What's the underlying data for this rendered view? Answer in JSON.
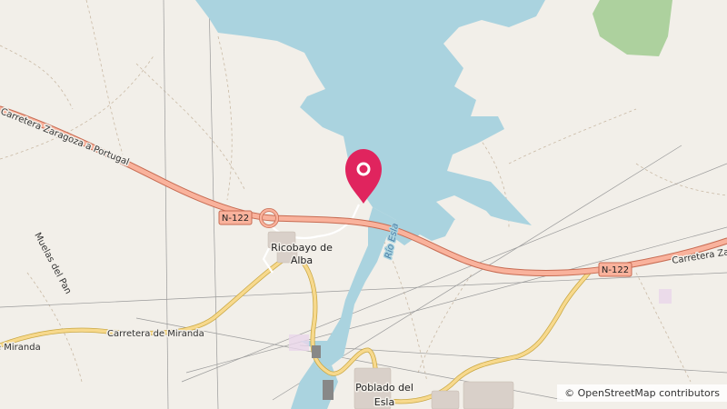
{
  "map": {
    "roads": {
      "n122_west_name": "Carretera Zaragoza a Portugal",
      "n122_east_name": "Carretera Zaragoza a Portugal",
      "miranda_name": "Carretera de Miranda",
      "shield_ref": "N-122"
    },
    "places": {
      "ricobayo_line1": "Ricobayo de",
      "ricobayo_line2": "Alba",
      "poblado_line1": "Poblado del",
      "poblado_line2": "Esla",
      "muelas": "Muelas del Pan"
    },
    "water": {
      "river": "Río Esla"
    },
    "marker": {
      "icon": "map-pin-icon",
      "color": "#e0245e"
    },
    "colors": {
      "land": "#f2efe9",
      "water": "#aad3df",
      "forest": "#add19e",
      "trunk_road": "#f9b29c",
      "secondary_road": "#f7d98d"
    }
  },
  "attribution": {
    "text": "© OpenStreetMap contributors"
  }
}
